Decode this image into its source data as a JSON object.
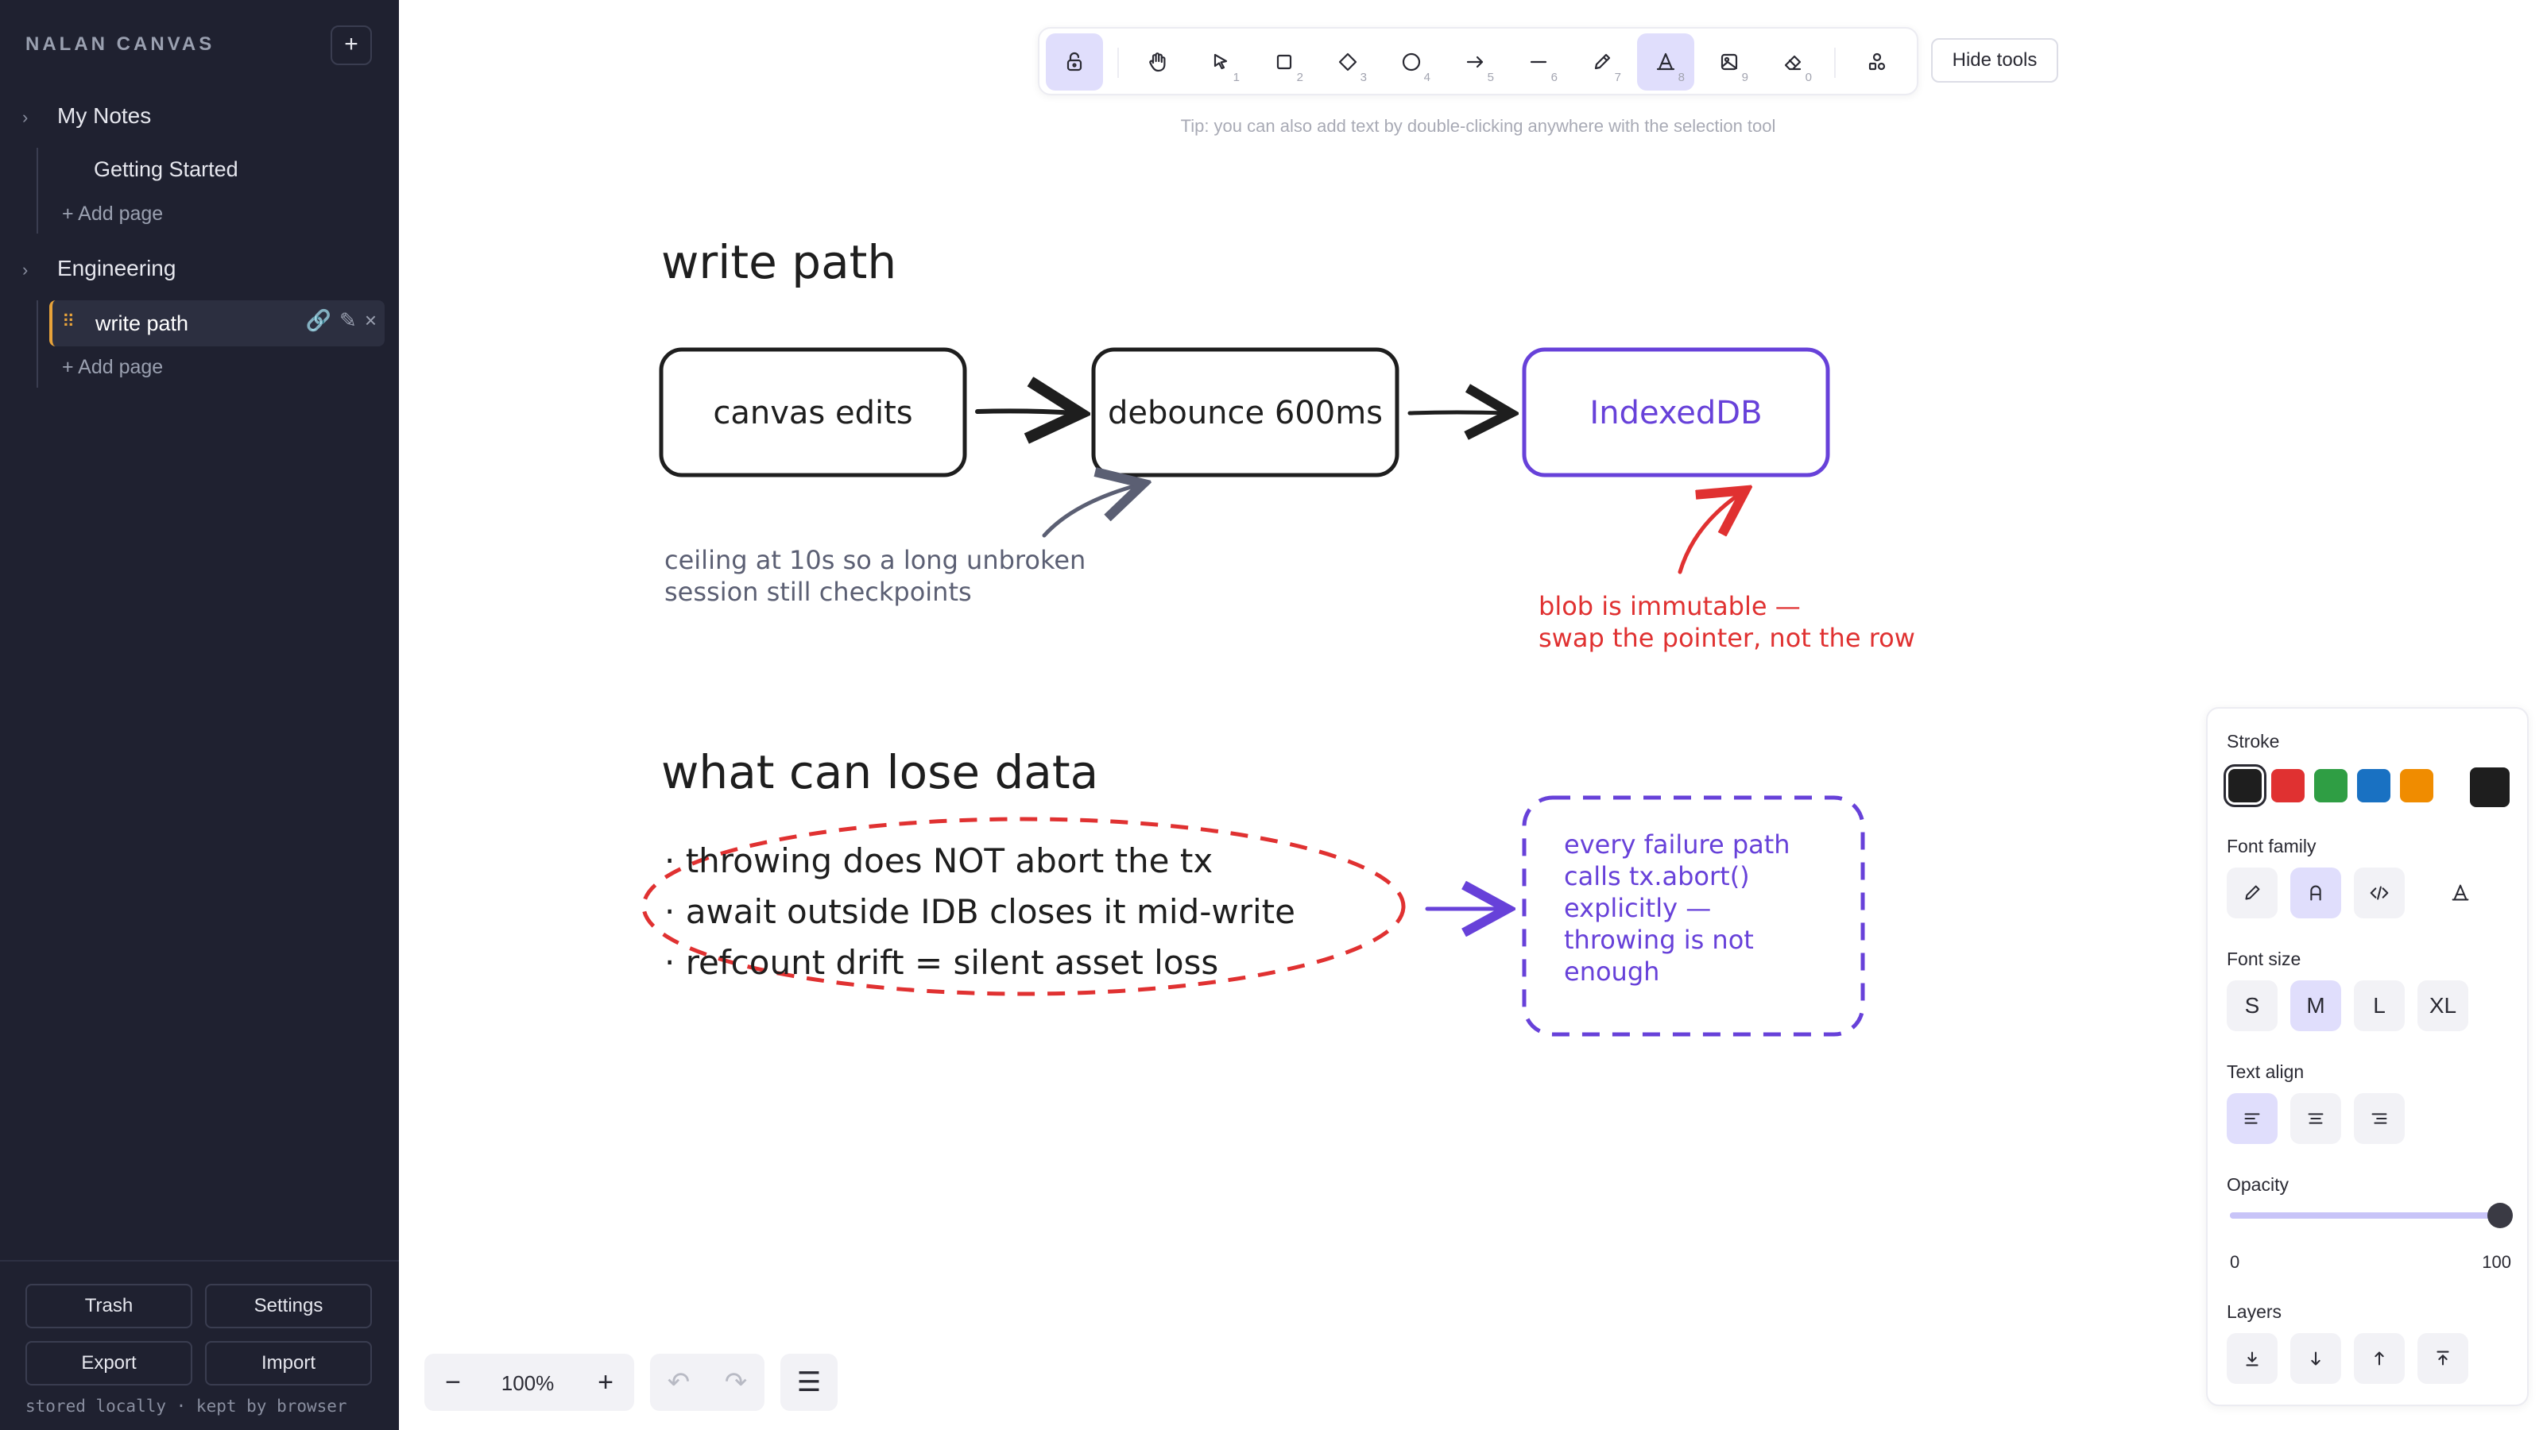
{
  "sidebar": {
    "brand": "NALAN CANVAS",
    "new_label": "+",
    "folders": [
      {
        "name": "My Notes",
        "pages": [
          "Getting Started"
        ],
        "add_label": "+ Add page"
      },
      {
        "name": "Engineering",
        "pages": [
          "write path"
        ],
        "add_label": "+ Add page"
      }
    ],
    "active_page": "write path",
    "footer": {
      "trash": "Trash",
      "settings": "Settings",
      "export": "Export",
      "import": "Import",
      "storage_note": "stored locally · kept by browser"
    }
  },
  "toolbar": {
    "tools": [
      {
        "name": "lock",
        "icon": "lock-icon",
        "key": "",
        "selected": true
      },
      {
        "name": "hand",
        "icon": "hand-icon",
        "key": "",
        "selected": false
      },
      {
        "name": "select",
        "icon": "pointer-icon",
        "key": "1",
        "selected": false
      },
      {
        "name": "rectangle",
        "icon": "square-icon",
        "key": "2",
        "selected": false
      },
      {
        "name": "diamond",
        "icon": "diamond-icon",
        "key": "3",
        "selected": false
      },
      {
        "name": "ellipse",
        "icon": "circle-icon",
        "key": "4",
        "selected": false
      },
      {
        "name": "arrow",
        "icon": "arrow-icon",
        "key": "5",
        "selected": false
      },
      {
        "name": "line",
        "icon": "line-icon",
        "key": "6",
        "selected": false
      },
      {
        "name": "draw",
        "icon": "pencil-icon",
        "key": "7",
        "selected": false
      },
      {
        "name": "text",
        "icon": "text-icon",
        "key": "8",
        "selected": true
      },
      {
        "name": "image",
        "icon": "image-icon",
        "key": "9",
        "selected": false
      },
      {
        "name": "eraser",
        "icon": "eraser-icon",
        "key": "0",
        "selected": false
      },
      {
        "name": "shapes",
        "icon": "shapes-icon",
        "key": "",
        "selected": false
      }
    ],
    "hide_tools": "Hide tools",
    "tip": "Tip: you can also add text by double-clicking anywhere with the selection tool"
  },
  "canvas": {
    "heading1": "write path",
    "box1": "canvas edits",
    "box2": "debounce 600ms",
    "box3": "IndexedDB",
    "note1": [
      "ceiling at 10s so a long unbroken",
      "session still checkpoints"
    ],
    "note2": [
      "blob is immutable —",
      "swap the pointer, not the row"
    ],
    "heading2": "what can lose data",
    "bullets": [
      "· throwing does NOT abort the tx",
      "· await outside IDB closes it mid-write",
      "· refcount drift = silent asset loss"
    ],
    "note3": [
      "every failure path",
      "calls tx.abort()",
      "explicitly —",
      "throwing is not",
      "enough"
    ],
    "colors": {
      "black": "#1e1e1e",
      "purple": "#6741d9",
      "red": "#e03131",
      "gray": "#5b5f73"
    }
  },
  "style_panel": {
    "stroke_title": "Stroke",
    "stroke_colors": [
      "#1e1e1e",
      "#e03131",
      "#2f9e44",
      "#1971c2",
      "#f08c00"
    ],
    "stroke_custom": "#1e1e1e",
    "font_family_title": "Font family",
    "font_family_icons": [
      "pencil-icon",
      "font-normal-icon",
      "code-icon",
      "font-hand-icon"
    ],
    "font_size_title": "Font size",
    "font_sizes": [
      "S",
      "M",
      "L",
      "XL"
    ],
    "font_size_selected": "M",
    "text_align_title": "Text align",
    "text_align_icons": [
      "align-left-icon",
      "align-center-icon",
      "align-right-icon"
    ],
    "opacity_title": "Opacity",
    "opacity_min": "0",
    "opacity_max": "100",
    "opacity_value": 100,
    "layers_title": "Layers",
    "layer_icons": [
      "send-to-back-icon",
      "send-backward-icon",
      "bring-forward-icon",
      "bring-to-front-icon"
    ]
  },
  "bottom": {
    "zoom_out": "−",
    "zoom": "100%",
    "zoom_in": "+",
    "undo": "↶",
    "redo": "↷",
    "menu": "☰"
  }
}
